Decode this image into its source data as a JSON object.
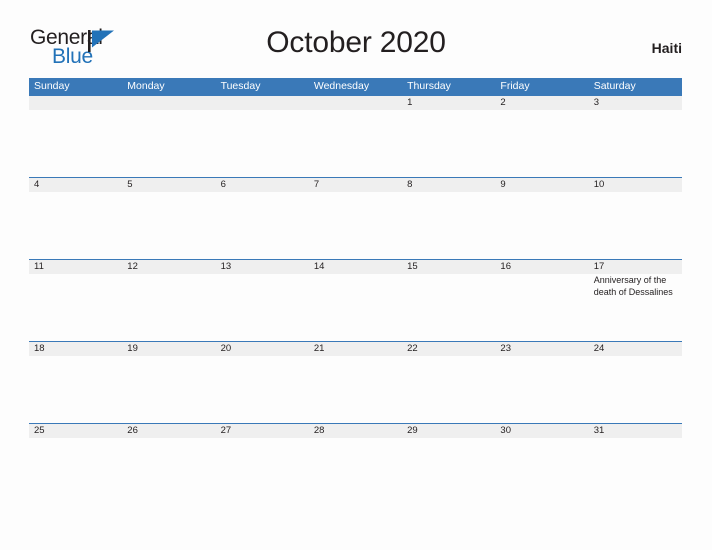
{
  "brand": {
    "name_part1": "General",
    "name_part2": "Blue",
    "flag_color": "#2272b8",
    "pole_color": "#231f20"
  },
  "header": {
    "title": "October 2020",
    "region": "Haiti"
  },
  "calendar": {
    "accent_color": "#3a79b8",
    "band_color": "#efefef",
    "weekdays": [
      "Sunday",
      "Monday",
      "Tuesday",
      "Wednesday",
      "Thursday",
      "Friday",
      "Saturday"
    ],
    "weeks": [
      {
        "days": [
          {
            "date": "",
            "event": ""
          },
          {
            "date": "",
            "event": ""
          },
          {
            "date": "",
            "event": ""
          },
          {
            "date": "",
            "event": ""
          },
          {
            "date": "1",
            "event": ""
          },
          {
            "date": "2",
            "event": ""
          },
          {
            "date": "3",
            "event": ""
          }
        ]
      },
      {
        "days": [
          {
            "date": "4",
            "event": ""
          },
          {
            "date": "5",
            "event": ""
          },
          {
            "date": "6",
            "event": ""
          },
          {
            "date": "7",
            "event": ""
          },
          {
            "date": "8",
            "event": ""
          },
          {
            "date": "9",
            "event": ""
          },
          {
            "date": "10",
            "event": ""
          }
        ]
      },
      {
        "days": [
          {
            "date": "11",
            "event": ""
          },
          {
            "date": "12",
            "event": ""
          },
          {
            "date": "13",
            "event": ""
          },
          {
            "date": "14",
            "event": ""
          },
          {
            "date": "15",
            "event": ""
          },
          {
            "date": "16",
            "event": ""
          },
          {
            "date": "17",
            "event": "Anniversary of the death of Dessalines"
          }
        ]
      },
      {
        "days": [
          {
            "date": "18",
            "event": ""
          },
          {
            "date": "19",
            "event": ""
          },
          {
            "date": "20",
            "event": ""
          },
          {
            "date": "21",
            "event": ""
          },
          {
            "date": "22",
            "event": ""
          },
          {
            "date": "23",
            "event": ""
          },
          {
            "date": "24",
            "event": ""
          }
        ]
      },
      {
        "days": [
          {
            "date": "25",
            "event": ""
          },
          {
            "date": "26",
            "event": ""
          },
          {
            "date": "27",
            "event": ""
          },
          {
            "date": "28",
            "event": ""
          },
          {
            "date": "29",
            "event": ""
          },
          {
            "date": "30",
            "event": ""
          },
          {
            "date": "31",
            "event": ""
          }
        ]
      }
    ]
  }
}
